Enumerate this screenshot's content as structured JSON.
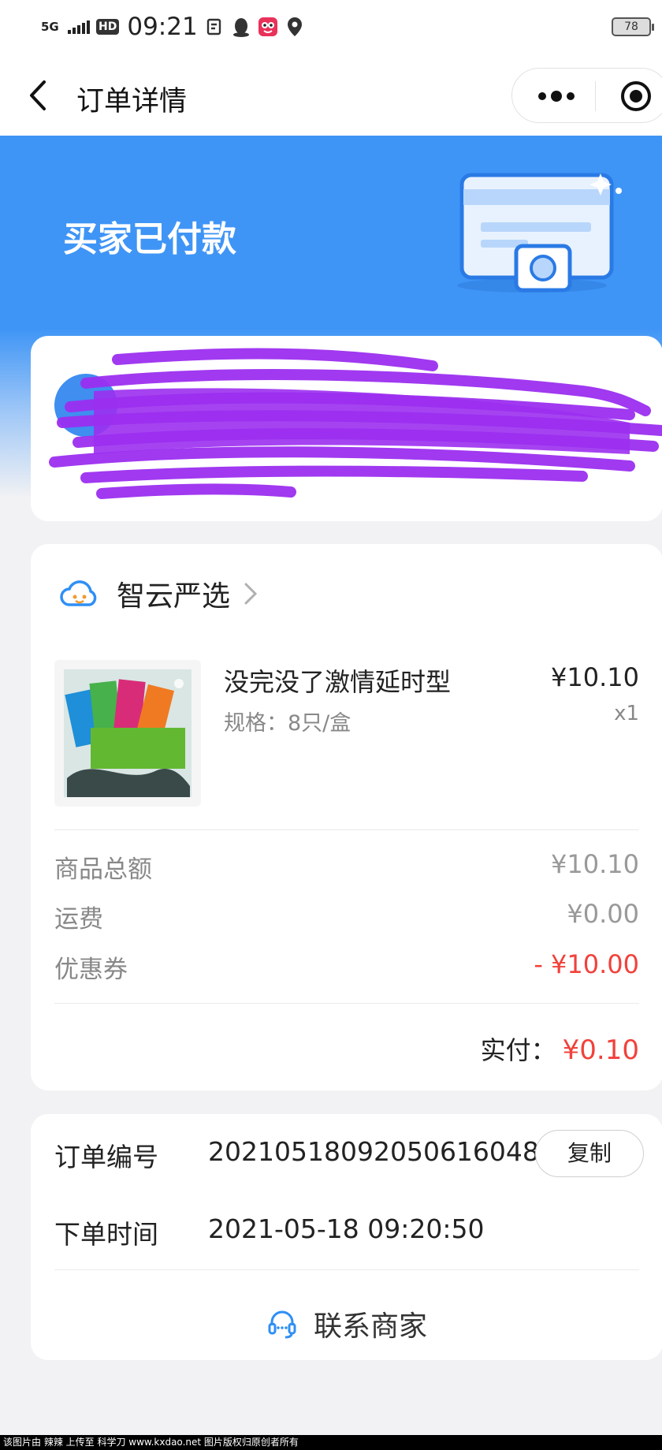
{
  "status_bar": {
    "network": "5G",
    "hd": "HD",
    "time": "09:21",
    "battery": "78",
    "icons": [
      "signal-icon",
      "sim-icon",
      "qq-icon",
      "app-icon",
      "location-pin-icon"
    ]
  },
  "nav": {
    "title": "订单详情",
    "back_icon": "chevron-left-icon",
    "more_icon": "more-dots-icon",
    "close_icon": "target-close-icon"
  },
  "hero": {
    "status_text": "买家已付款",
    "illustration": "payment-card-illustration"
  },
  "shop": {
    "name": "智云严选",
    "icon": "cloud-face-icon"
  },
  "product": {
    "name": "没完没了激情延时型",
    "spec": "规格：8只/盒",
    "price": "¥10.10",
    "quantity": "x1",
    "thumb_icon": "product-box-image"
  },
  "fees": [
    {
      "label": "商品总额",
      "value": "¥10.10",
      "highlight": false
    },
    {
      "label": "运费",
      "value": "¥0.00",
      "highlight": false
    },
    {
      "label": "优惠券",
      "value": "- ¥10.00",
      "highlight": true
    }
  ],
  "paid": {
    "label": "实付：",
    "value": "¥0.10"
  },
  "order": {
    "number_label": "订单编号",
    "number_value": "2021051809205061604 8",
    "copy_label": "复制",
    "time_label": "下单时间",
    "time_value": "2021-05-18 09:20:50"
  },
  "contact": {
    "label": "联系商家",
    "icon": "headset-icon"
  },
  "footer": {
    "watermark": "该图片由 辣辣 上传至 科学刀 www.kxdao.net 图片版权归原创者所有"
  },
  "colors": {
    "primary_blue": "#3f95f6",
    "price_red": "#f2413b",
    "redaction_purple": "#9b2ff0"
  }
}
